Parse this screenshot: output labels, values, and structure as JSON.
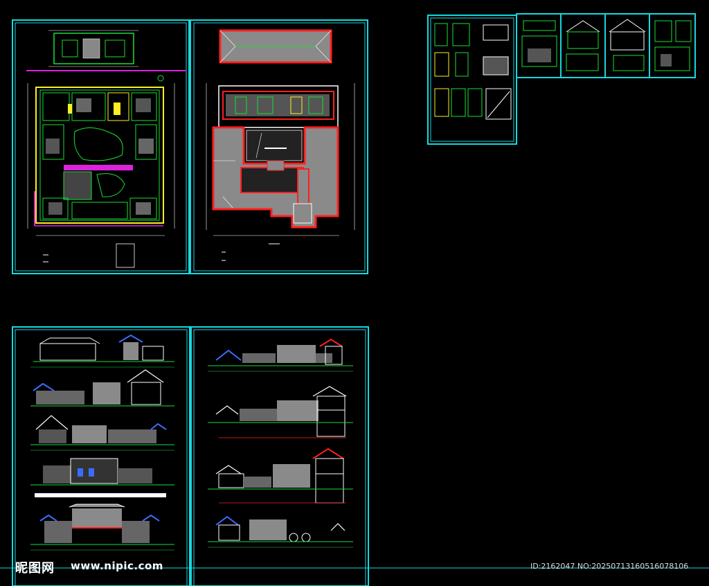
{
  "watermark": {
    "logo": "昵图网",
    "url": "www.nipic.com",
    "id_text": "ID:2162047 NO:20250713160516078106"
  },
  "colors": {
    "background": "#000000",
    "frame": "#17d8e0",
    "line": "#19e036",
    "dim": "#ffffff",
    "wall_red": "#ff2020",
    "roof_gray": "#8a8a8a",
    "accent_yellow": "#ffee22",
    "accent_magenta": "#dd22dd",
    "accent_blue": "#3a6cff"
  },
  "sheets": [
    {
      "name": "floor-plan-sheet",
      "kind": "plan"
    },
    {
      "name": "roof-plan-sheet",
      "kind": "roof"
    },
    {
      "name": "elevations-sheet-1",
      "kind": "elevations"
    },
    {
      "name": "sections-sheet-2",
      "kind": "sections"
    },
    {
      "name": "detail-sheet-a",
      "kind": "details"
    },
    {
      "name": "detail-sheet-b",
      "kind": "details"
    },
    {
      "name": "detail-sheet-c",
      "kind": "details"
    },
    {
      "name": "detail-sheet-d",
      "kind": "details"
    },
    {
      "name": "detail-sheet-e",
      "kind": "details"
    }
  ]
}
